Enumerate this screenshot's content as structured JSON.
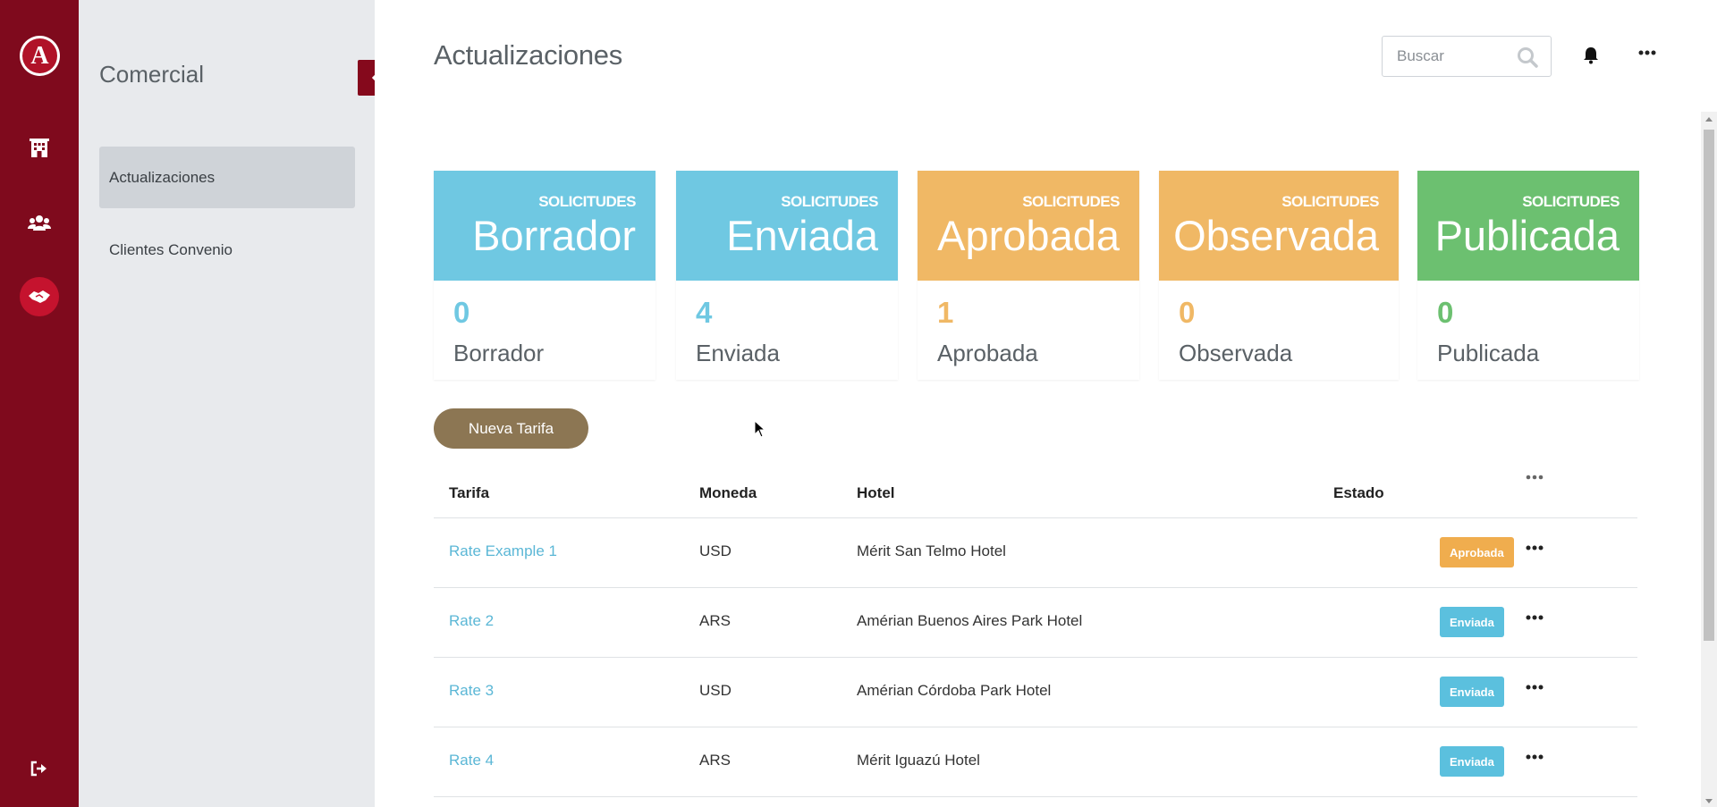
{
  "brand": {
    "logo_letter": "A"
  },
  "rail": {
    "icons": [
      "hotel-icon",
      "users-icon",
      "handshake-icon",
      "logout-icon"
    ]
  },
  "sidebar": {
    "title": "Comercial",
    "items": [
      {
        "label": "Actualizaciones",
        "active": true
      },
      {
        "label": "Clientes Convenio",
        "active": false
      }
    ]
  },
  "header": {
    "title": "Actualizaciones",
    "search_placeholder": "Buscar"
  },
  "cards": [
    {
      "overline": "SOLICITUDES",
      "title": "Borrador",
      "count": "0",
      "label": "Borrador",
      "color": "#6fc8e2"
    },
    {
      "overline": "SOLICITUDES",
      "title": "Enviada",
      "count": "4",
      "label": "Enviada",
      "color": "#6fc8e2"
    },
    {
      "overline": "SOLICITUDES",
      "title": "Aprobada",
      "count": "1",
      "label": "Aprobada",
      "color": "#f0b865"
    },
    {
      "overline": "SOLICITUDES",
      "title": "Observada",
      "count": "0",
      "label": "Observada",
      "color": "#f0b865"
    },
    {
      "overline": "SOLICITUDES",
      "title": "Publicada",
      "count": "0",
      "label": "Publicada",
      "color": "#6cc070"
    }
  ],
  "new_button": "Nueva Tarifa",
  "table": {
    "headers": {
      "tarifa": "Tarifa",
      "moneda": "Moneda",
      "hotel": "Hotel",
      "estado": "Estado"
    },
    "rows": [
      {
        "tarifa": "Rate Example 1",
        "moneda": "USD",
        "hotel": "Mérit San Telmo Hotel",
        "estado": "Aprobada",
        "estado_color": "#f0ad4e"
      },
      {
        "tarifa": "Rate 2",
        "moneda": "ARS",
        "hotel": "Amérian Buenos Aires Park Hotel",
        "estado": "Enviada",
        "estado_color": "#5bc0de"
      },
      {
        "tarifa": "Rate 3",
        "moneda": "USD",
        "hotel": "Amérian Córdoba Park Hotel",
        "estado": "Enviada",
        "estado_color": "#5bc0de"
      },
      {
        "tarifa": "Rate 4",
        "moneda": "ARS",
        "hotel": "Mérit Iguazú Hotel",
        "estado": "Enviada",
        "estado_color": "#5bc0de"
      }
    ]
  },
  "colors": {
    "rail": "#7f0a1d",
    "sidebar": "#e8eaed",
    "accent_button": "#8c7653",
    "link": "#5bb7d6"
  }
}
